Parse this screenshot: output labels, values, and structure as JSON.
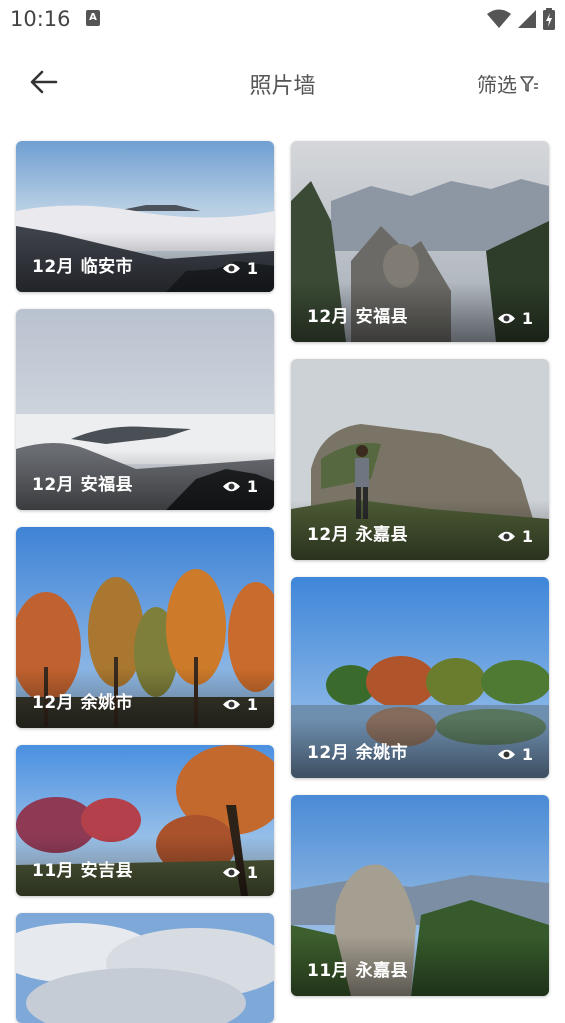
{
  "status_bar": {
    "time": "10:16",
    "notification_badge": "A"
  },
  "app_bar": {
    "title": "照片墙",
    "filter_label": "筛选"
  },
  "left_column": [
    {
      "month": "12月",
      "place": "临安市",
      "views": "1",
      "scene": "sea-of-clouds"
    },
    {
      "month": "12月",
      "place": "安福县",
      "views": "1",
      "scene": "mist-ridge"
    },
    {
      "month": "12月",
      "place": "余姚市",
      "views": "1",
      "scene": "autumn-trees"
    },
    {
      "month": "11月",
      "place": "安吉县",
      "views": "1",
      "scene": "red-foliage"
    },
    {
      "month": "",
      "place": "",
      "views": "",
      "scene": "cloudy-sky"
    }
  ],
  "right_column": [
    {
      "month": "12月",
      "place": "安福县",
      "views": "1",
      "scene": "pine-peaks"
    },
    {
      "month": "12月",
      "place": "永嘉县",
      "views": "1",
      "scene": "rock-cliff-person"
    },
    {
      "month": "12月",
      "place": "余姚市",
      "views": "1",
      "scene": "lake-reflection"
    },
    {
      "month": "11月",
      "place": "永嘉县",
      "views": "1",
      "scene": "rock-peak"
    }
  ],
  "icons": [
    "back-arrow-icon",
    "filter-icon",
    "eye-icon",
    "wifi-icon",
    "signal-icon",
    "battery-icon"
  ]
}
